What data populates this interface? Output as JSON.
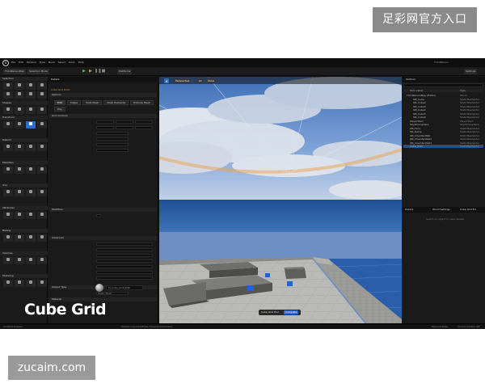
{
  "watermark_top": "足彩网官方入口",
  "watermark_bottom": "zucaim.com",
  "caption": "Cube Grid",
  "editor": {
    "logo": "U",
    "menu": [
      "File",
      "Edit",
      "Window",
      "Tools",
      "Build",
      "Select",
      "Actor",
      "Help"
    ],
    "window_title": "ThirdPerson",
    "toolbar": {
      "save": "ThirdPersonMap",
      "mode": "Selection Mode",
      "platforms": "Platforms",
      "settings": "Settings"
    }
  },
  "modes": {
    "sections": [
      "Selection",
      "Shapes",
      "Transform",
      "Deform",
      "MeshOps",
      "UVs",
      "Attributes",
      "Baking",
      "Volumes",
      "Modeling"
    ]
  },
  "details": {
    "tab": "Details",
    "title": "Cube Grid Actor",
    "tabs": [
      "Edit",
      "Shape",
      "Multi Mesh",
      "Mesh Elements",
      "Extrude Mesh",
      "Poly"
    ],
    "sections": [
      "Options",
      "Grid Controls",
      "Modifiers",
      "Advanced",
      "Output Type",
      "Material"
    ],
    "output_type_value": "Static Mesh",
    "material_value": "M_Cube_Grid_Mat"
  },
  "viewport": {
    "perspective": "Perspective",
    "lit": "Lit",
    "show": "Show",
    "accept_label": "Cube Grid Tool",
    "accept_button": "Complete"
  },
  "outliner": {
    "tab": "Outliner",
    "columns": [
      "Item Label",
      "Type"
    ],
    "rows": [
      {
        "name": "ThirdPersonMap (Editor)",
        "type": "World",
        "indent": 0
      },
      {
        "name": "SM_Cube",
        "type": "StaticMeshActor",
        "indent": 2
      },
      {
        "name": "SM_Cube2",
        "type": "StaticMeshActor",
        "indent": 2
      },
      {
        "name": "SM_Cube3",
        "type": "StaticMeshActor",
        "indent": 2
      },
      {
        "name": "SM_Cube4",
        "type": "StaticMeshActor",
        "indent": 2
      },
      {
        "name": "SM_Cube5",
        "type": "StaticMeshActor",
        "indent": 2
      },
      {
        "name": "SM_Cube6",
        "type": "StaticMeshActor",
        "indent": 2
      },
      {
        "name": "PlayerStart",
        "type": "PlayerStart",
        "indent": 1
      },
      {
        "name": "SkyAtmosphere",
        "type": "SkyAtmosphere",
        "indent": 1
      },
      {
        "name": "SM_Floor",
        "type": "StaticMeshActor",
        "indent": 1
      },
      {
        "name": "SM_Ramp",
        "type": "StaticMeshActor",
        "indent": 1
      },
      {
        "name": "SM_ChamferWall",
        "type": "StaticMeshActor",
        "indent": 1
      },
      {
        "name": "SM_ChamferWall2",
        "type": "StaticMeshActor",
        "indent": 1
      },
      {
        "name": "SM_ChamferWall3",
        "type": "StaticMeshActor",
        "indent": 1
      },
      {
        "name": "Cube_Grid",
        "type": "StaticMeshActor",
        "indent": 1
      }
    ],
    "bottom_tabs": [
      "Details",
      "World Settings",
      "Cube Grid Ed"
    ],
    "empty": "Select an object to view details."
  },
  "status": {
    "left": "Content Drawer",
    "center": "Output Log   Cmd   Enter Console Command",
    "right_a": "Derived Data",
    "right_b": "Source Control Off"
  },
  "colors": {
    "accent_blue": "#2a6fd0",
    "cube_blue": "#1f62e0",
    "orange_label": "#e38a2c"
  }
}
